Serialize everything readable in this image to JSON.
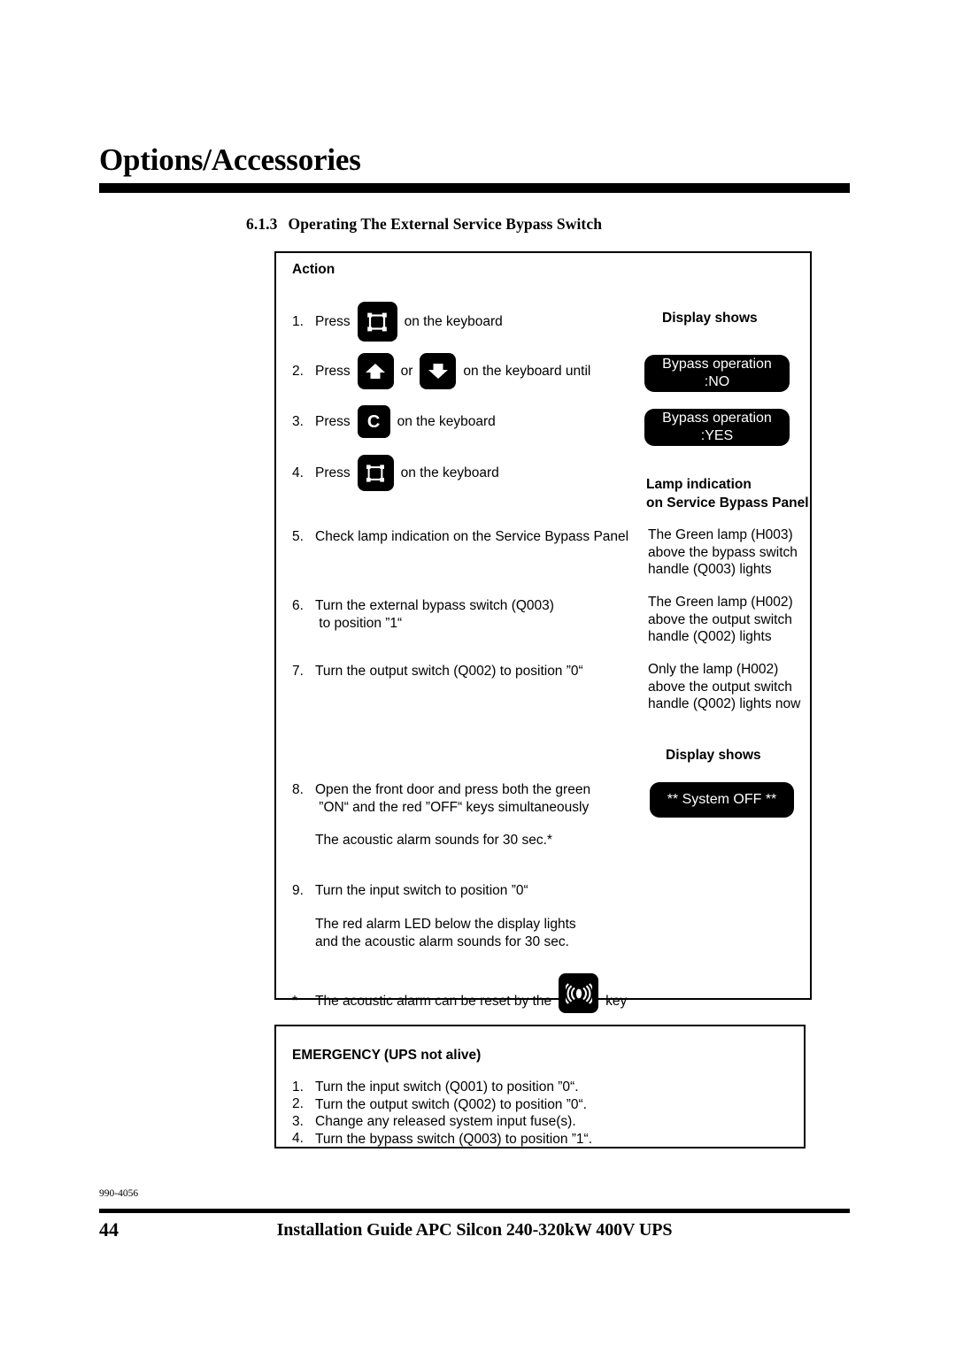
{
  "header": {
    "chapter_title": "Options/Accessories",
    "section_number": "6.1.3",
    "section_title": "Operating The External Service Bypass Switch"
  },
  "procedure": {
    "action_header": "Action",
    "display_header_1": "Display shows",
    "lamp_header_line1": "Lamp indication",
    "lamp_header_line2": "on Service Bypass Panel",
    "display_header_2": "Display shows",
    "steps": [
      {
        "num": "1.",
        "verb": "Press",
        "icon": "display-frame-icon",
        "after": "on the keyboard"
      },
      {
        "num": "2.",
        "verb": "Press",
        "icon": "arrow-up-icon",
        "or": "or",
        "icon2": "arrow-down-icon",
        "after": "on the keyboard until"
      },
      {
        "num": "3.",
        "verb": "Press",
        "icon": "key-c-icon",
        "icon_letter": "C",
        "after": "on the keyboard"
      },
      {
        "num": "4.",
        "verb": "Press",
        "icon": "display-frame-icon",
        "after": "on the keyboard"
      }
    ],
    "step5": {
      "num": "5.",
      "text": "Check lamp indication on the Service Bypass Panel",
      "result": "The Green lamp (H003)\nabove the bypass switch\nhandle (Q003) lights"
    },
    "step6": {
      "num": "6.",
      "text": "Turn the external bypass switch (Q003)\n to position ”1“",
      "result": "The Green lamp (H002)\nabove the output switch\nhandle (Q002) lights"
    },
    "step7": {
      "num": "7.",
      "text": "Turn the output switch (Q002) to position ”0“",
      "result": "Only the lamp (H002)\nabove the output switch\nhandle (Q002) lights now"
    },
    "step8": {
      "num": "8.",
      "text": "Open the front door and press both the green\n ”ON“ and the red ”OFF“ keys simultaneously",
      "note": "The acoustic alarm sounds for 30 sec.*"
    },
    "step9": {
      "num": "9.",
      "text": "Turn the input switch to position ”0“",
      "note": "The red alarm LED below the display lights\nand the acoustic alarm sounds for 30 sec."
    },
    "footnote": {
      "marker": "*",
      "text_before": "The acoustic alarm can be reset by the",
      "icon": "acoustic-alarm-icon",
      "text_after": "key"
    },
    "lcd_bypass_no": {
      "line1": "Bypass operation",
      "line2": ":NO"
    },
    "lcd_bypass_yes": {
      "line1": "Bypass operation",
      "line2": ":YES"
    },
    "lcd_system_off": {
      "line1": "** System OFF **"
    }
  },
  "emergency": {
    "title": "EMERGENCY (UPS not alive)",
    "items": [
      {
        "num": "1.",
        "text": "Turn the input switch (Q001) to position ”0“."
      },
      {
        "num": "2.",
        "text": "Turn the output switch (Q002) to position ”0“."
      },
      {
        "num": "3.",
        "text": "Change any released system input fuse(s)."
      },
      {
        "num": "4.",
        "text": "Turn the bypass switch (Q003) to position ”1“."
      }
    ]
  },
  "footer": {
    "doc_number": "990-4056",
    "page_number": "44",
    "title": "Installation Guide APC Silcon 240-320kW 400V UPS"
  },
  "colors": {
    "ink": "#000000",
    "paper": "#ffffff",
    "lcd_bg": "#000000",
    "lcd_text": "#ffffff"
  }
}
